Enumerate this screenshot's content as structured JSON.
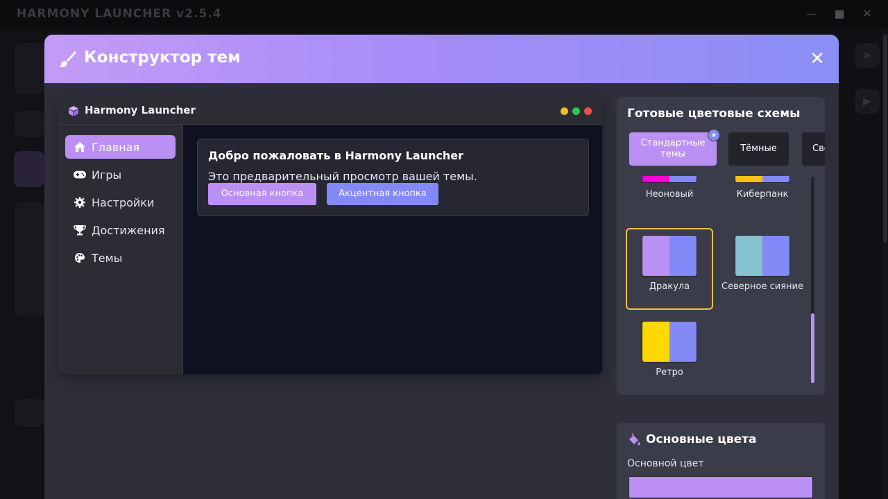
{
  "app": {
    "title": "HARMONY LAUNCHER v2.5.4",
    "controls": [
      "—",
      "■",
      "✕"
    ]
  },
  "modal": {
    "title": "Конструктор тем",
    "close": "✕"
  },
  "preview": {
    "title": "Harmony Launcher",
    "nav": [
      {
        "label": "Главная",
        "icon": "home-icon"
      },
      {
        "label": "Игры",
        "icon": "gamepad-icon"
      },
      {
        "label": "Настройки",
        "icon": "gear-icon"
      },
      {
        "label": "Достижения",
        "icon": "trophy-icon"
      },
      {
        "label": "Темы",
        "icon": "palette-icon"
      }
    ],
    "welcome_title": "Добро пожаловать в Harmony Launcher",
    "welcome_text": "Это предварительный просмотр вашей темы.",
    "primary_button": "Основная кнопка",
    "accent_button": "Акцентная кнопка"
  },
  "schemes": {
    "title": "Готовые цветовые схемы",
    "tabs": {
      "standard": "Стандартные темы",
      "dark": "Тёмные",
      "light": "Светлые"
    },
    "items": [
      {
        "name": "Неоновый",
        "colors": [
          "#ff00d4",
          "#8389f7"
        ]
      },
      {
        "name": "Киберпанк",
        "colors": [
          "#f2c314",
          "#8389f7"
        ]
      },
      {
        "name": "Дракула",
        "colors": [
          "#bb90f4",
          "#8389f7"
        ]
      },
      {
        "name": "Северное сияние",
        "colors": [
          "#88c1cf",
          "#8389f7"
        ]
      },
      {
        "name": "Ретро",
        "colors": [
          "#ffd800",
          "#8389f7"
        ]
      }
    ],
    "selected": "Дракула"
  },
  "base_colors": {
    "title": "Основные цвета",
    "primary_label": "Основной цвет",
    "primary_value": "#bb90f4"
  },
  "colors": {
    "accent": "#8389f7",
    "primary": "#bb90f4",
    "selected_border": "#f0c14b"
  }
}
